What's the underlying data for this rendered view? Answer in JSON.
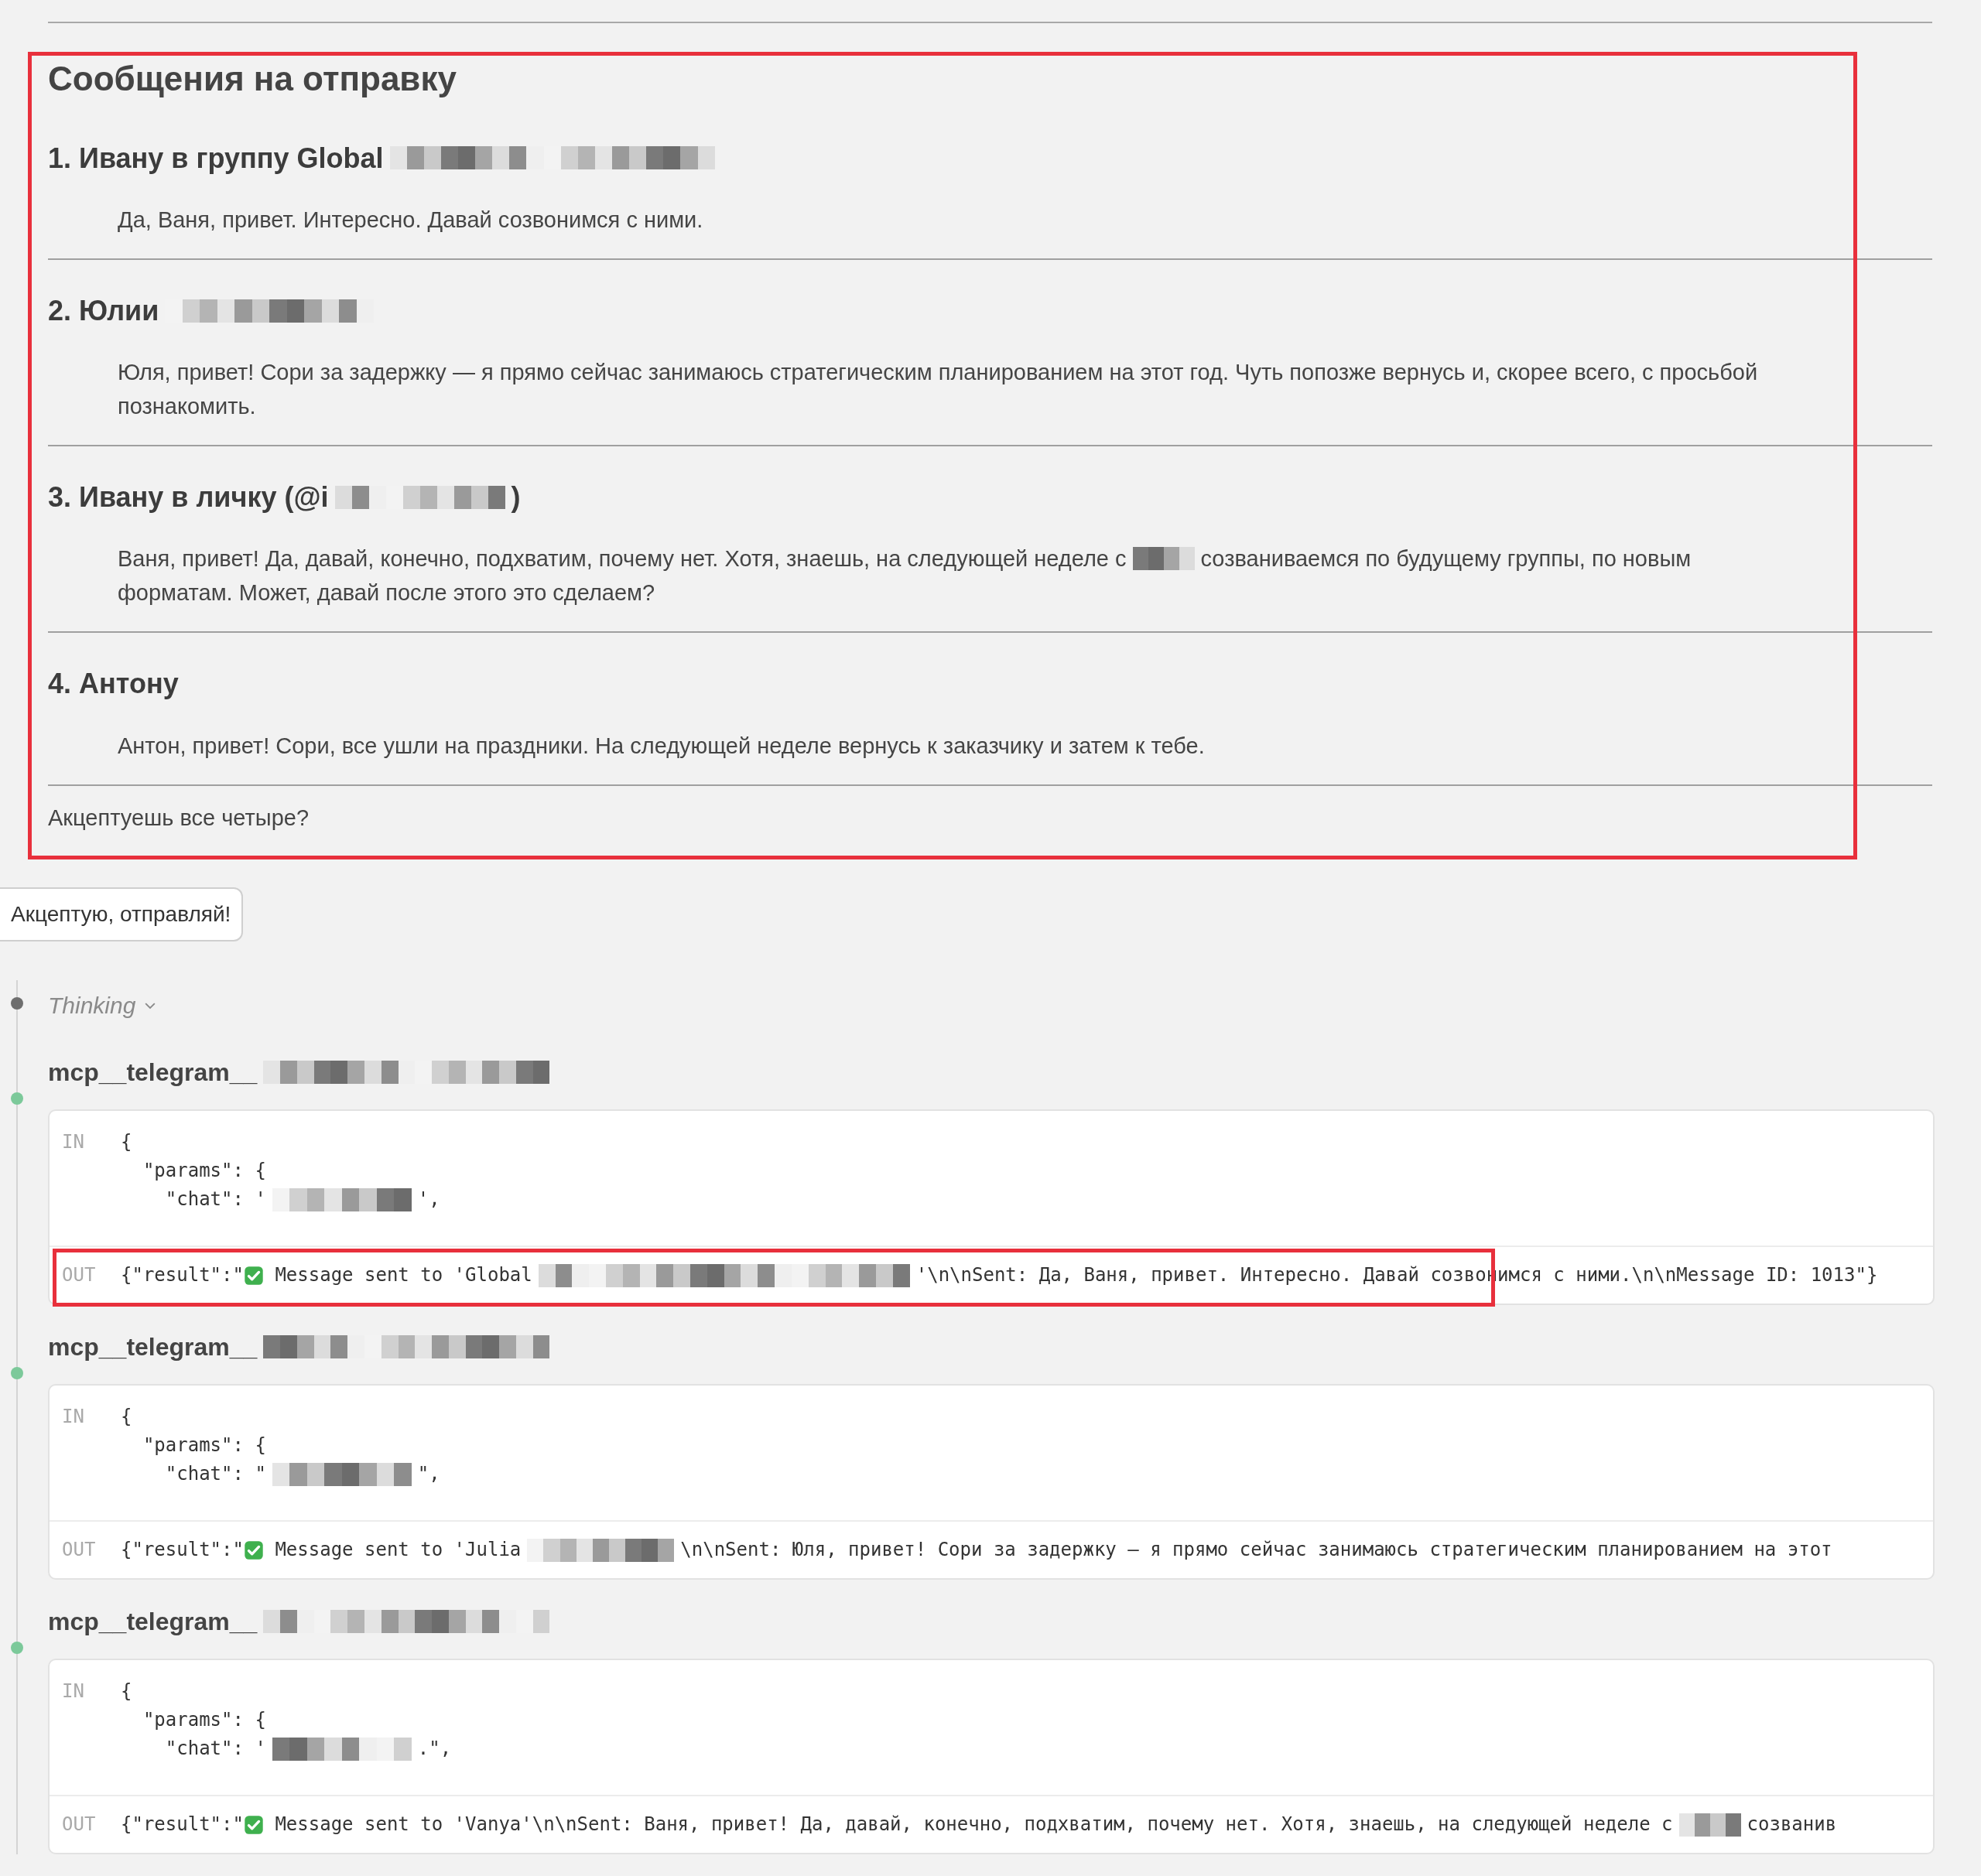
{
  "messages_section": {
    "title": "Сообщения на отправку",
    "highlighted": true,
    "items": [
      {
        "heading": [
          {
            "kind": "text",
            "text": "1. Ивану в группу Global"
          },
          {
            "kind": "redacted"
          }
        ],
        "body": [
          [
            {
              "kind": "text",
              "text": "Да, Ваня, привет. Интересно. Давай созвонимся с ними."
            }
          ]
        ]
      },
      {
        "heading": [
          {
            "kind": "text",
            "text": "2. Юлии"
          },
          {
            "kind": "redacted"
          }
        ],
        "body": [
          [
            {
              "kind": "text",
              "text": "Юля, привет! Сори за задержку — я прямо сейчас занимаюсь стратегическим планированием на этот год. Чуть попозже вернусь и, скорее всего, с просьбой познакомить."
            }
          ]
        ]
      },
      {
        "heading": [
          {
            "kind": "text",
            "text": "3. Ивану в личку (@i"
          },
          {
            "kind": "redacted"
          },
          {
            "kind": "text",
            "text": ")"
          }
        ],
        "body": [
          [
            {
              "kind": "text",
              "text": "Ваня, привет! Да, давай, конечно, подхватим, почему нет. Хотя, знаешь, на следующей неделе с"
            },
            {
              "kind": "redacted"
            },
            {
              "kind": "text",
              "text": "созваниваемся по будущему группы, по новым"
            }
          ],
          [
            {
              "kind": "text",
              "text": "форматам. Может, давай после этого это сделаем?"
            }
          ]
        ]
      },
      {
        "heading": [
          {
            "kind": "text",
            "text": "4. Антону"
          }
        ],
        "body": [
          [
            {
              "kind": "text",
              "text": "Антон, привет! Сори, все ушли на праздники. На следующей неделе вернусь к заказчику и затем к тебе."
            }
          ]
        ]
      }
    ],
    "question": "Акцептуешь все четыре?"
  },
  "user_reply": "Акцептую, отправляй!",
  "timeline": [
    {
      "kind": "thinking",
      "color": "#6e6e6e",
      "label": "Thinking"
    },
    {
      "kind": "tool",
      "color": "#7cc99a",
      "title": [
        {
          "kind": "text",
          "text": "mcp__telegram__"
        },
        {
          "kind": "redacted"
        }
      ],
      "in_label": "IN",
      "in_lines": [
        [
          {
            "kind": "text",
            "text": "{"
          }
        ],
        [
          {
            "kind": "text",
            "text": "  \"params\": {"
          }
        ],
        [
          {
            "kind": "text",
            "text": "    \"chat\": '"
          },
          {
            "kind": "redacted"
          },
          {
            "kind": "text",
            "text": "',"
          }
        ]
      ],
      "out_label": "OUT",
      "out_highlighted": true,
      "out": [
        {
          "kind": "text",
          "text": "{\"result\":\""
        },
        {
          "kind": "check"
        },
        {
          "kind": "text",
          "text": " Message sent to 'Global"
        },
        {
          "kind": "redacted"
        },
        {
          "kind": "text",
          "text": "'\\n\\nSent: Да, Ваня, привет. Интересно. Давай созвонимся с ними.\\n\\nMessage ID: 1013\"}"
        }
      ]
    },
    {
      "kind": "tool",
      "color": "#7cc99a",
      "title": [
        {
          "kind": "text",
          "text": "mcp__telegram__"
        },
        {
          "kind": "redacted"
        }
      ],
      "in_label": "IN",
      "in_lines": [
        [
          {
            "kind": "text",
            "text": "{"
          }
        ],
        [
          {
            "kind": "text",
            "text": "  \"params\": {"
          }
        ],
        [
          {
            "kind": "text",
            "text": "    \"chat\": \""
          },
          {
            "kind": "redacted"
          },
          {
            "kind": "text",
            "text": "\","
          }
        ]
      ],
      "out_label": "OUT",
      "out_highlighted": false,
      "out": [
        {
          "kind": "text",
          "text": "{\"result\":\""
        },
        {
          "kind": "check"
        },
        {
          "kind": "text",
          "text": " Message sent to 'Julia"
        },
        {
          "kind": "redacted"
        },
        {
          "kind": "text",
          "text": "\\n\\nSent: Юля, привет! Сори за задержку — я прямо сейчас занимаюсь стратегическим планированием на этот"
        }
      ]
    },
    {
      "kind": "tool",
      "color": "#7cc99a",
      "title": [
        {
          "kind": "text",
          "text": "mcp__telegram__"
        },
        {
          "kind": "redacted"
        }
      ],
      "in_label": "IN",
      "in_lines": [
        [
          {
            "kind": "text",
            "text": "{"
          }
        ],
        [
          {
            "kind": "text",
            "text": "  \"params\": {"
          }
        ],
        [
          {
            "kind": "text",
            "text": "    \"chat\": '"
          },
          {
            "kind": "redacted"
          },
          {
            "kind": "text",
            "text": ".\","
          }
        ]
      ],
      "out_label": "OUT",
      "out_highlighted": false,
      "out": [
        {
          "kind": "text",
          "text": "{\"result\":\""
        },
        {
          "kind": "check"
        },
        {
          "kind": "text",
          "text": " Message sent to 'Vanya'\\n\\nSent: Ваня, привет! Да, давай, конечно, подхватим, почему нет. Хотя, знаешь, на следующей неделе с"
        },
        {
          "kind": "redacted"
        },
        {
          "kind": "text",
          "text": "созванив"
        }
      ]
    }
  ]
}
